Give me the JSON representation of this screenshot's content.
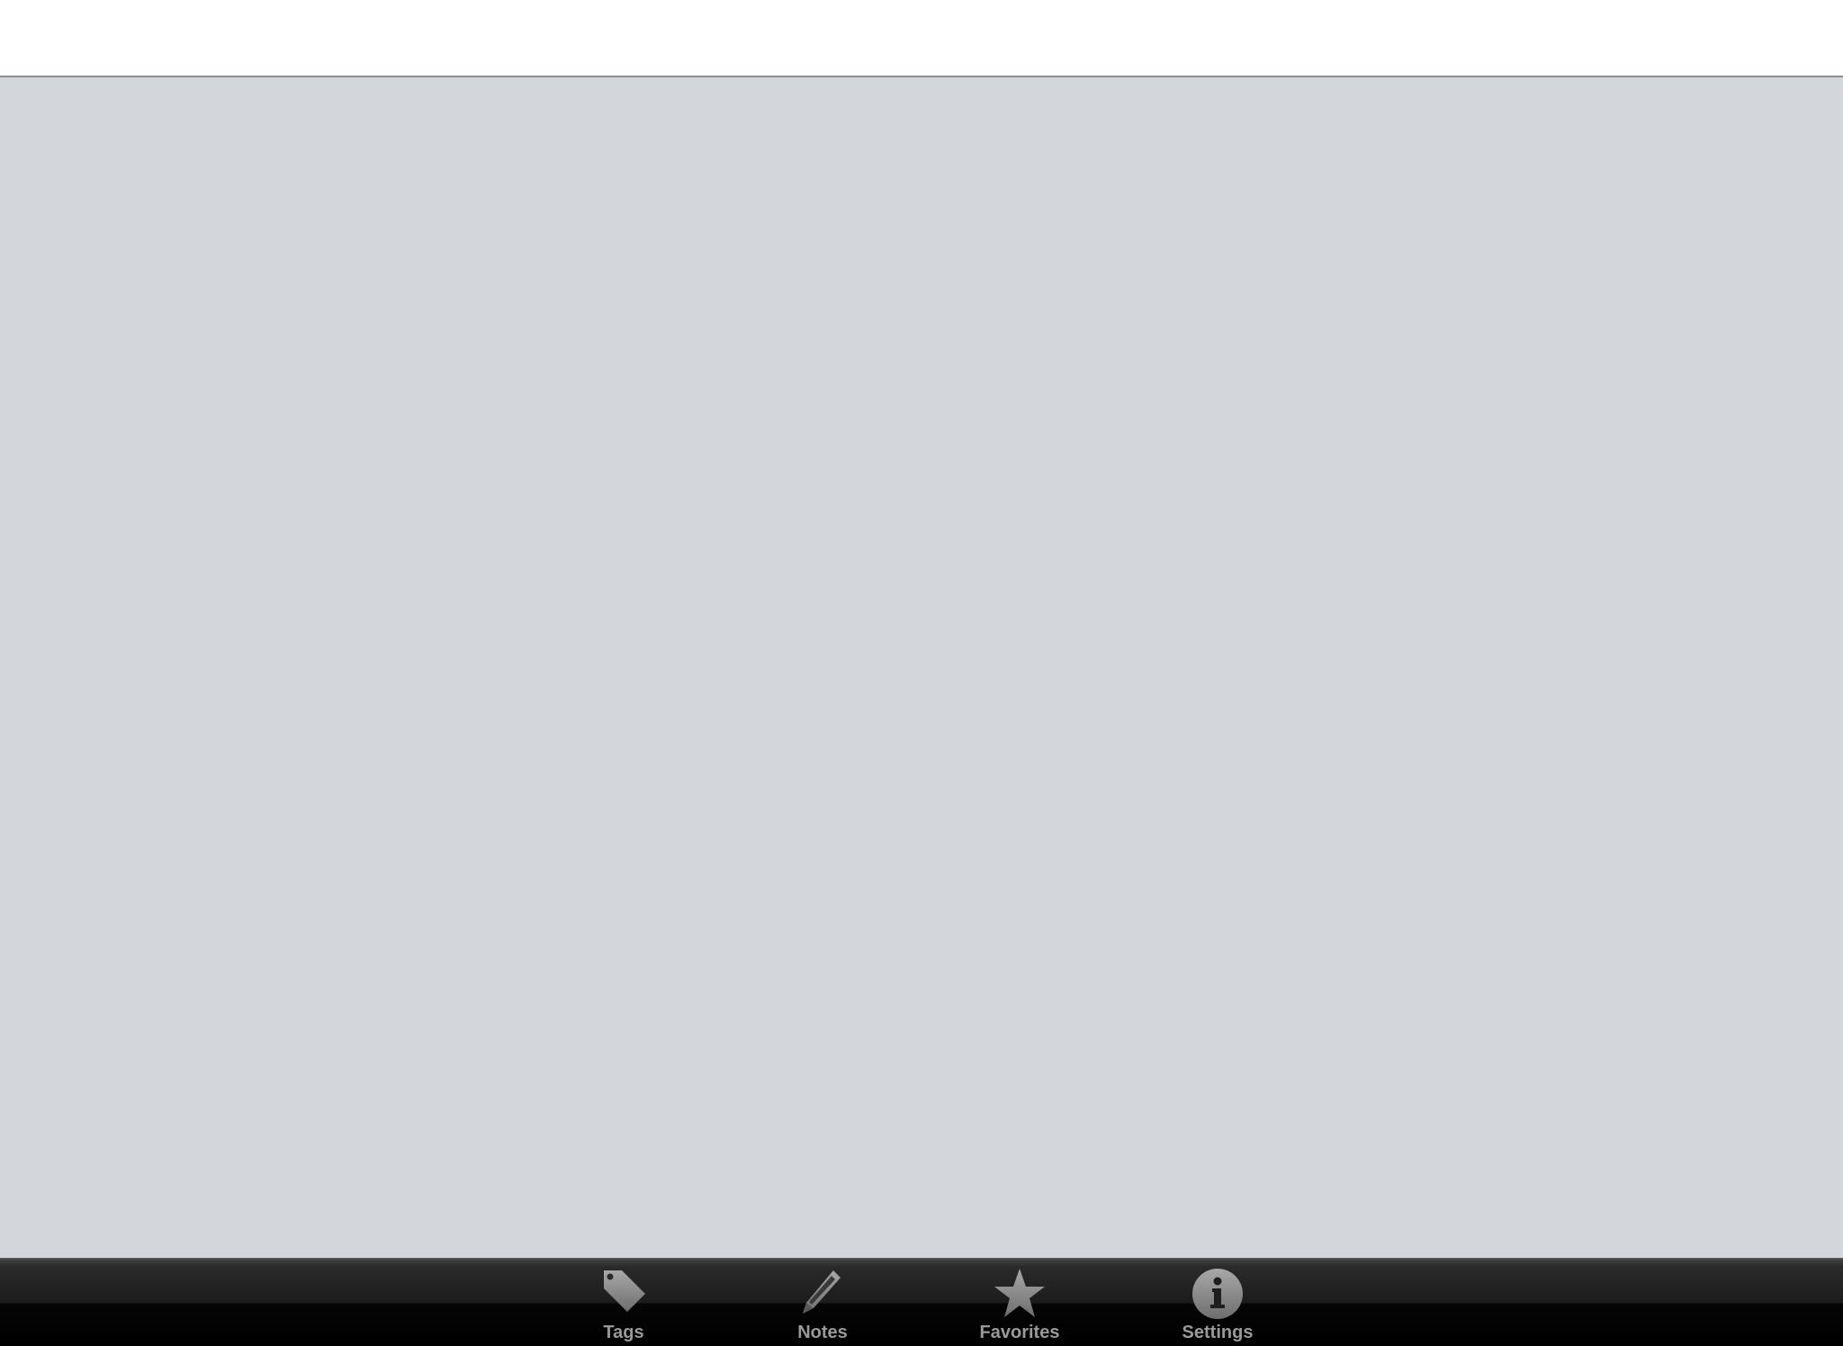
{
  "tab_bar": {
    "tabs": [
      {
        "id": "tags",
        "label": "Tags",
        "icon": "tag-icon"
      },
      {
        "id": "notes",
        "label": "Notes",
        "icon": "pencil-icon"
      },
      {
        "id": "favorites",
        "label": "Favorites",
        "icon": "star-icon"
      },
      {
        "id": "settings",
        "label": "Settings",
        "icon": "info-icon"
      }
    ]
  },
  "colors": {
    "content_background": "#d3d6db",
    "tab_label": "#9a9a9a",
    "tab_icon": "#8c8c8c"
  }
}
